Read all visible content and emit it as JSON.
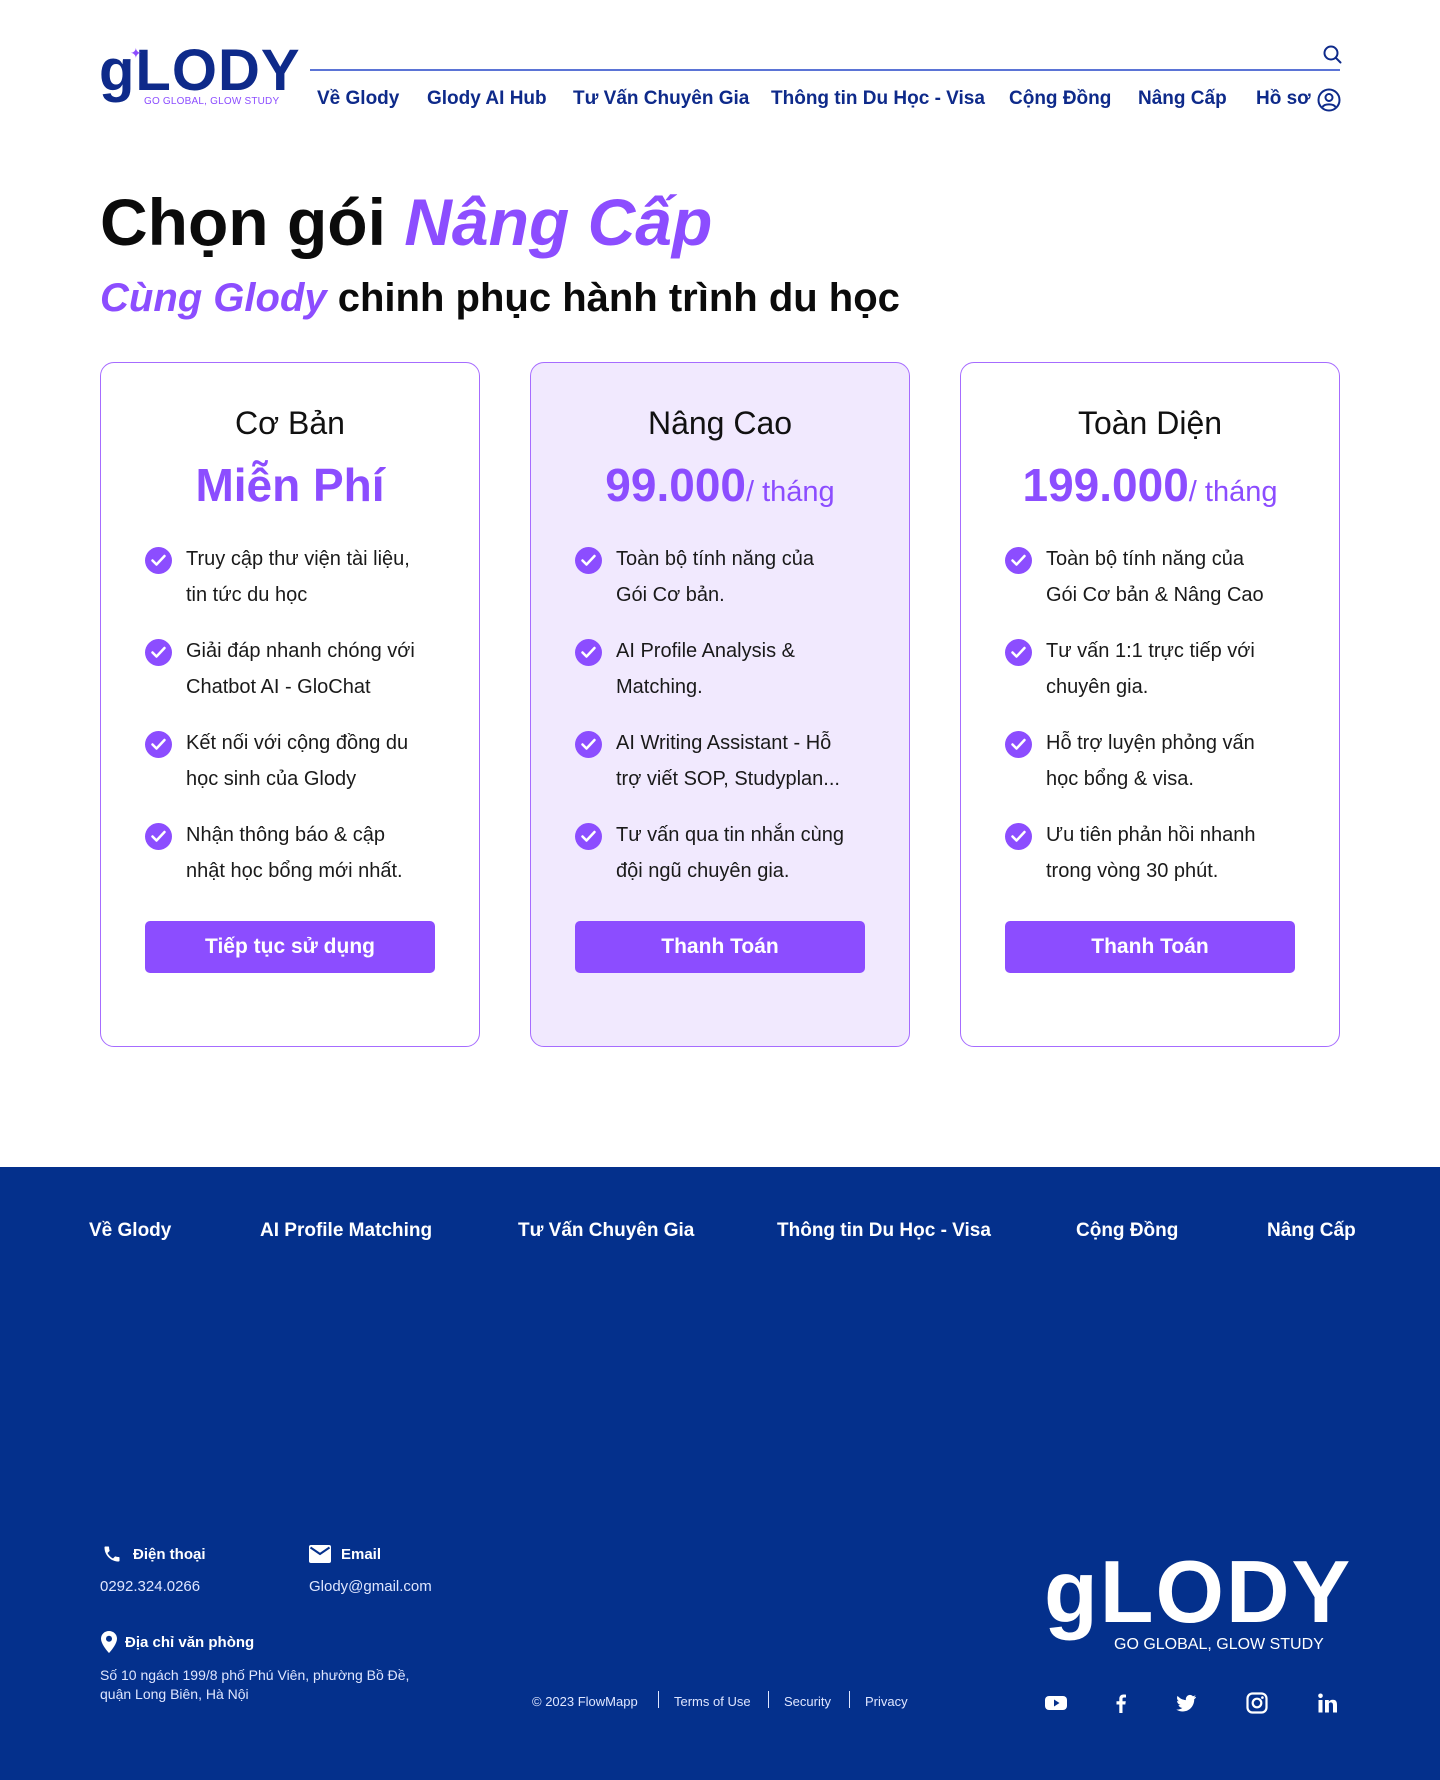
{
  "brand": {
    "logo_text": "gLODY",
    "tagline": "GO GLOBAL, GLOW STUDY"
  },
  "nav": {
    "items": [
      "Về Glody",
      "Glody AI Hub",
      "Tư Vấn Chuyên Gia",
      "Thông tin Du Học - Visa",
      "Cộng Đồng",
      "Nâng Cấp",
      "Hồ sơ"
    ]
  },
  "hero": {
    "title_prefix": "Chọn gói ",
    "title_accent": "Nâng Cấp",
    "subtitle_accent": "Cùng Glody",
    "subtitle_rest": " chinh phục hành trình du học"
  },
  "plans": [
    {
      "name": "Cơ Bản",
      "price": "Miễn Phí",
      "per": "",
      "features": [
        [
          "Truy cập thư viện tài liệu,",
          "tin tức du học"
        ],
        [
          "Giải đáp nhanh chóng với",
          "Chatbot AI - GloChat"
        ],
        [
          "Kết nối với cộng đồng du",
          "học sinh của Glody"
        ],
        [
          "Nhận thông báo & cập",
          "nhật học bổng mới nhất."
        ]
      ],
      "button": "Tiếp tục sử dụng"
    },
    {
      "name": "Nâng Cao",
      "price": "99.000",
      "per": "/ tháng",
      "features": [
        [
          "Toàn bộ tính năng của",
          "Gói Cơ bản."
        ],
        [
          "AI Profile Analysis &",
          "Matching."
        ],
        [
          "AI Writing Assistant - Hỗ",
          "trợ viết SOP, Studyplan..."
        ],
        [
          "Tư vấn qua tin nhắn cùng",
          "đội ngũ chuyên gia."
        ]
      ],
      "button": "Thanh Toán"
    },
    {
      "name": "Toàn Diện",
      "price": "199.000",
      "per": "/ tháng",
      "features": [
        [
          "Toàn bộ tính năng của",
          "Gói Cơ bản & Nâng Cao"
        ],
        [
          "Tư vấn 1:1 trực tiếp với",
          "chuyên gia."
        ],
        [
          "Hỗ trợ luyện phỏng vấn",
          "học bổng & visa."
        ],
        [
          "Ưu tiên phản hồi nhanh",
          "trong vòng 30 phút."
        ]
      ],
      "button": "Thanh Toán"
    }
  ],
  "footer": {
    "nav": [
      "Về Glody",
      "AI Profile Matching",
      "Tư Vấn Chuyên Gia",
      "Thông tin Du Học - Visa",
      "Cộng Đồng",
      "Nâng Cấp"
    ],
    "phone_label": "Điện thoại",
    "phone": "0292.324.0266",
    "email_label": "Email",
    "email": "Glody@gmail.com",
    "address_label": "Địa chỉ văn phòng",
    "address": "Số 10 ngách 199/8 phố Phú Viên, phường Bồ Đề, quận Long Biên, Hà Nội",
    "copyright": "© 2023 FlowMapp",
    "terms": "Terms of Use",
    "security": "Security",
    "privacy": "Privacy",
    "logo_text": "gLODY",
    "tagline": "GO GLOBAL, GLOW STUDY",
    "social": [
      "youtube-icon",
      "facebook-icon",
      "twitter-icon",
      "instagram-icon",
      "linkedin-icon"
    ]
  },
  "colors": {
    "brand_blue": "#0e2a8a",
    "accent_purple": "#8c4dff",
    "footer_bg": "#04308c",
    "highlight_card": "#f1e9fe"
  }
}
